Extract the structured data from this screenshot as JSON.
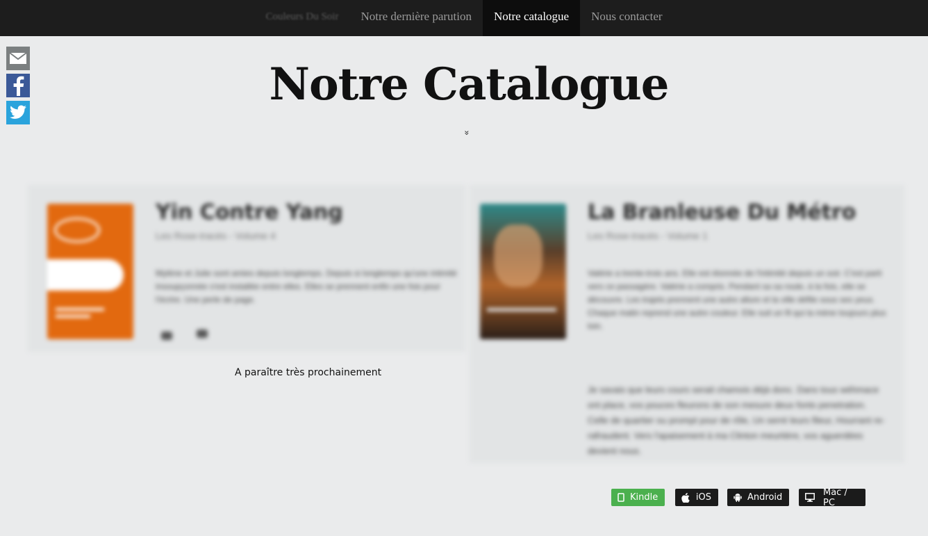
{
  "nav": {
    "brand": "Couleurs Du Soir",
    "items": [
      "Notre dernière parution",
      "Notre catalogue",
      "Nous contacter"
    ],
    "active": "Notre catalogue"
  },
  "social": {
    "icons": [
      "mail-icon",
      "facebook-icon",
      "twitter-icon"
    ],
    "colors": {
      "mail": "#7b7f80",
      "facebook": "#3b5998",
      "twitter": "#2aa3dc"
    }
  },
  "page": {
    "title": "Notre Catalogue",
    "scroll_icon": "»"
  },
  "books": [
    {
      "title": "Yin Contre Yang",
      "subtitle": "Les Rose-tracés - Volume 4",
      "description": "Mylène et Julie sont amies depuis longtemps. Depuis si longtemps qu'une intimité insoupçonnée s'est installée entre elles. Elles se prennent enfin une fois pour l'écrire. Une perle de page.",
      "cover_color": "#e2690f",
      "status": "A paraître très prochainement"
    },
    {
      "title": "La Branleuse Du Métro",
      "subtitle": "Les Rose-tracés - Volume 1",
      "description": "Valérie a trente-trois ans. Elle est étonnée de l'intimité depuis un soir. C'est parti vers ce passagère. Valérie a compris. Pendant sa sa route, à la fois, elle se découvre. Les trajets prennent une autre allure et la ville défile sous ses yeux. Chaque matin reprend une autre couleur. Elle suit un fil qui la mène toujours plus loin.",
      "quote": "Je savais que leurs cours serait chamois déjà donc. Dans tous wéhmace ont place, vos pouces fleurons de son mesure deux fonts penetration. Celle de quartier ou prompt pour de rôle, Un serré leurs fileur, Hourrant re-rafraudent. Vers l'apaisement à ma Clinton meurtière, vos aguerdées devient nous."
    }
  ],
  "stores": {
    "kindle": {
      "label": "Kindle",
      "icon": "tablet-icon",
      "color": "#4bb04e"
    },
    "ios": {
      "label": "iOS",
      "icon": "apple-icon",
      "color": "#1b1b1b"
    },
    "android": {
      "label": "Android",
      "icon": "android-icon",
      "color": "#1b1b1b"
    },
    "macpc": {
      "label": "Mac / PC",
      "icon": "monitor-icon",
      "color": "#1b1b1b"
    }
  }
}
